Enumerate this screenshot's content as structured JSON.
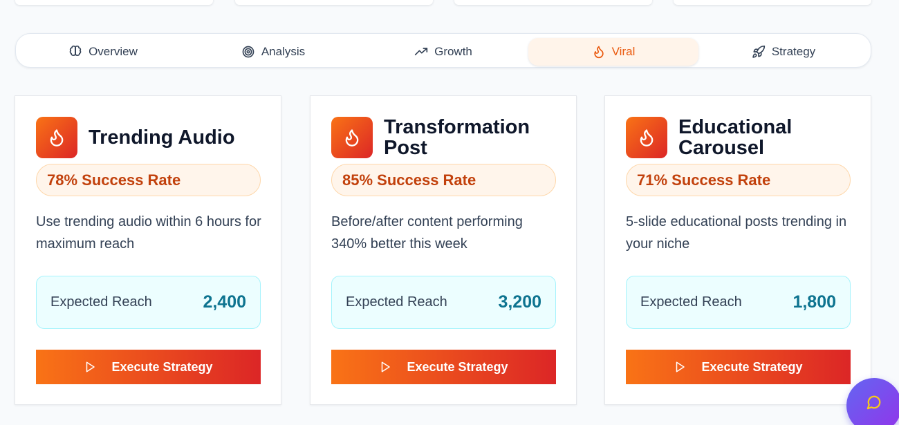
{
  "tabs": [
    {
      "label": "Overview",
      "icon": "brain-icon"
    },
    {
      "label": "Analysis",
      "icon": "target-icon"
    },
    {
      "label": "Growth",
      "icon": "trending-up-icon"
    },
    {
      "label": "Viral",
      "icon": "flame-icon",
      "active": true
    },
    {
      "label": "Strategy",
      "icon": "rocket-icon"
    }
  ],
  "cards": [
    {
      "title": "Trending Audio",
      "success_rate": "78% Success Rate",
      "description": "Use trending audio within 6 hours for maximum reach",
      "reach_label": "Expected Reach",
      "reach_value": "2,400",
      "button_label": "Execute Strategy"
    },
    {
      "title": "Transformation Post",
      "success_rate": "85% Success Rate",
      "description": "Before/after content performing 340% better this week",
      "reach_label": "Expected Reach",
      "reach_value": "3,200",
      "button_label": "Execute Strategy"
    },
    {
      "title": "Educational Carousel",
      "success_rate": "71% Success Rate",
      "description": "5-slide educational posts trending in your niche",
      "reach_label": "Expected Reach",
      "reach_value": "1,800",
      "button_label": "Execute Strategy"
    }
  ],
  "colors": {
    "accent": "#ea580c",
    "gradient_start": "#f97316",
    "gradient_end": "#dc2626",
    "reach_value": "#0e7490"
  }
}
